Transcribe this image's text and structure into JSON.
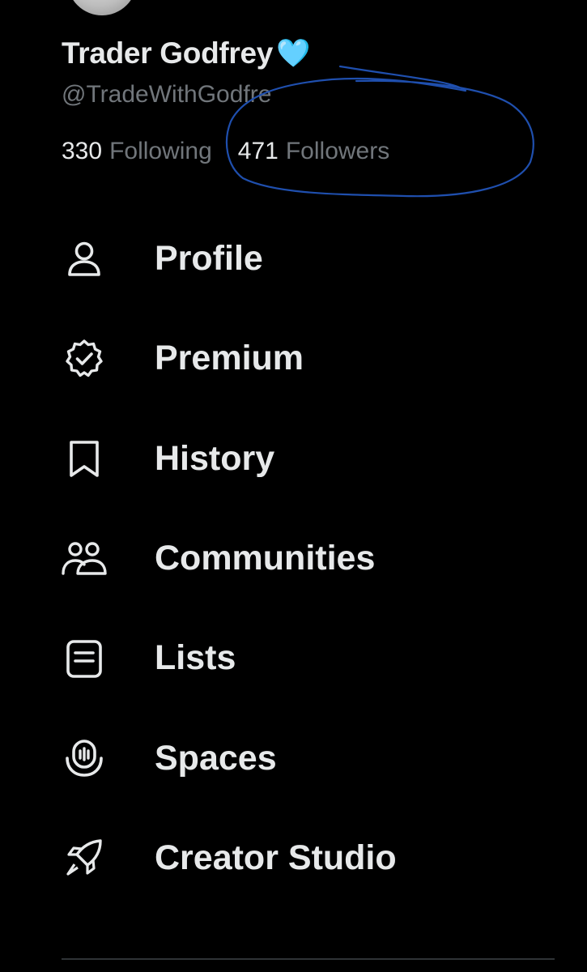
{
  "profile": {
    "display_name": "Trader Godfrey",
    "verified_heart": "🩵",
    "handle": "@TradeWithGodfre",
    "following_count": "330",
    "following_label": "Following",
    "followers_count": "471",
    "followers_label": "Followers"
  },
  "annotation": {
    "color": "#1f4fae"
  },
  "menu": {
    "items": [
      {
        "label": "Profile",
        "icon": "person-icon"
      },
      {
        "label": "Premium",
        "icon": "verified-badge-icon"
      },
      {
        "label": "History",
        "icon": "bookmark-icon"
      },
      {
        "label": "Communities",
        "icon": "communities-icon"
      },
      {
        "label": "Lists",
        "icon": "lists-icon"
      },
      {
        "label": "Spaces",
        "icon": "spaces-icon"
      },
      {
        "label": "Creator Studio",
        "icon": "rocket-icon"
      }
    ]
  }
}
